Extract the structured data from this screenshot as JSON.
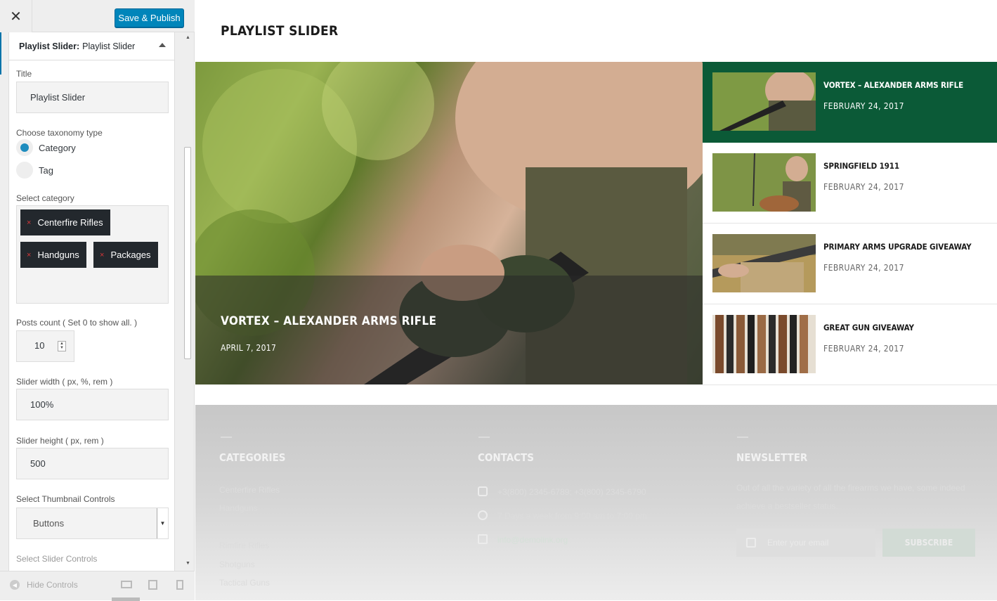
{
  "customizer": {
    "close_icon": "close-icon",
    "publish_label": "Save & Publish",
    "widget": {
      "type": "Playlist Slider:",
      "name": "Playlist Slider"
    },
    "title": {
      "label": "Title",
      "value": "Playlist Slider"
    },
    "taxonomy": {
      "label": "Choose taxonomy type",
      "options": [
        "Category",
        "Tag"
      ],
      "selected": "Category"
    },
    "category": {
      "label": "Select category",
      "tags": [
        "Centerfire Rifles",
        "Handguns",
        "Packages"
      ],
      "remove_glyph": "×"
    },
    "posts_count": {
      "label": "Posts count ( Set 0 to show all. )",
      "value": "10"
    },
    "slider_width": {
      "label": "Slider width ( px, %, rem )",
      "value": "100%"
    },
    "slider_height": {
      "label": "Slider height ( px, rem )",
      "value": "500"
    },
    "thumb_controls": {
      "label": "Select Thumbnail Controls",
      "value": "Buttons"
    },
    "slider_controls": {
      "label": "Select Slider Controls"
    },
    "footer": {
      "hide_controls": "Hide Controls",
      "devices": [
        "desktop-icon",
        "tablet-icon",
        "mobile-icon"
      ],
      "active_device": "desktop"
    },
    "accent": "#0085ba"
  },
  "preview": {
    "page_title": "PLAYLIST SLIDER",
    "main_slide": {
      "title": "VORTEX – ALEXANDER ARMS RIFLE",
      "date": "APRIL 7, 2017"
    },
    "playlist": [
      {
        "title": "VORTEX – ALEXANDER ARMS RIFLE",
        "date": "FEBRUARY 24, 2017",
        "active": true
      },
      {
        "title": "SPRINGFIELD 1911",
        "date": "FEBRUARY 24, 2017",
        "active": false
      },
      {
        "title": "PRIMARY ARMS UPGRADE GIVEAWAY",
        "date": "FEBRUARY 24, 2017",
        "active": false
      },
      {
        "title": "GREAT GUN GIVEAWAY",
        "date": "FEBRUARY 24, 2017",
        "active": false
      }
    ],
    "active_color": "#0b5a37",
    "footer": {
      "categories": {
        "heading": "CATEGORIES",
        "links": [
          "Centerfire Rifles",
          "Handguns",
          "Packages",
          "Rimfire Rifles",
          "Shotguns",
          "Tactical Guns"
        ]
      },
      "contacts": {
        "heading": "CONTACTS",
        "phone": "+3(800) 2345-6789; +3(800) 2345-6790",
        "hours": "7 Days a week from 9:00 am to 7:00 pm",
        "email": "info@demolink.org"
      },
      "newsletter": {
        "heading": "NEWSLETTER",
        "text_line1": "Out of all the variety of all the firearms we have, some indeed",
        "text_line2": "achieve a bestseller status.",
        "placeholder": "Enter your email",
        "button": "SUBSCRIBE"
      }
    }
  }
}
